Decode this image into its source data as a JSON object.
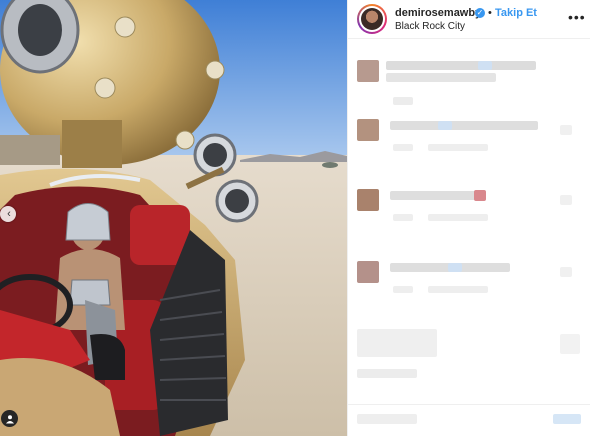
{
  "post": {
    "username": "demirosemawby",
    "verified_glyph": "✓",
    "separator": "•",
    "follow_label": "Takip Et",
    "location": "Black Rock City",
    "more_glyph": "•••"
  },
  "icons": {
    "nav_left": "chevron-left-icon",
    "tagged_user": "user-tag-icon",
    "verified": "verified-badge-icon",
    "more": "more-options-icon"
  },
  "colors": {
    "link_blue": "#3897f0",
    "text": "#262626",
    "divider": "#efefef"
  }
}
